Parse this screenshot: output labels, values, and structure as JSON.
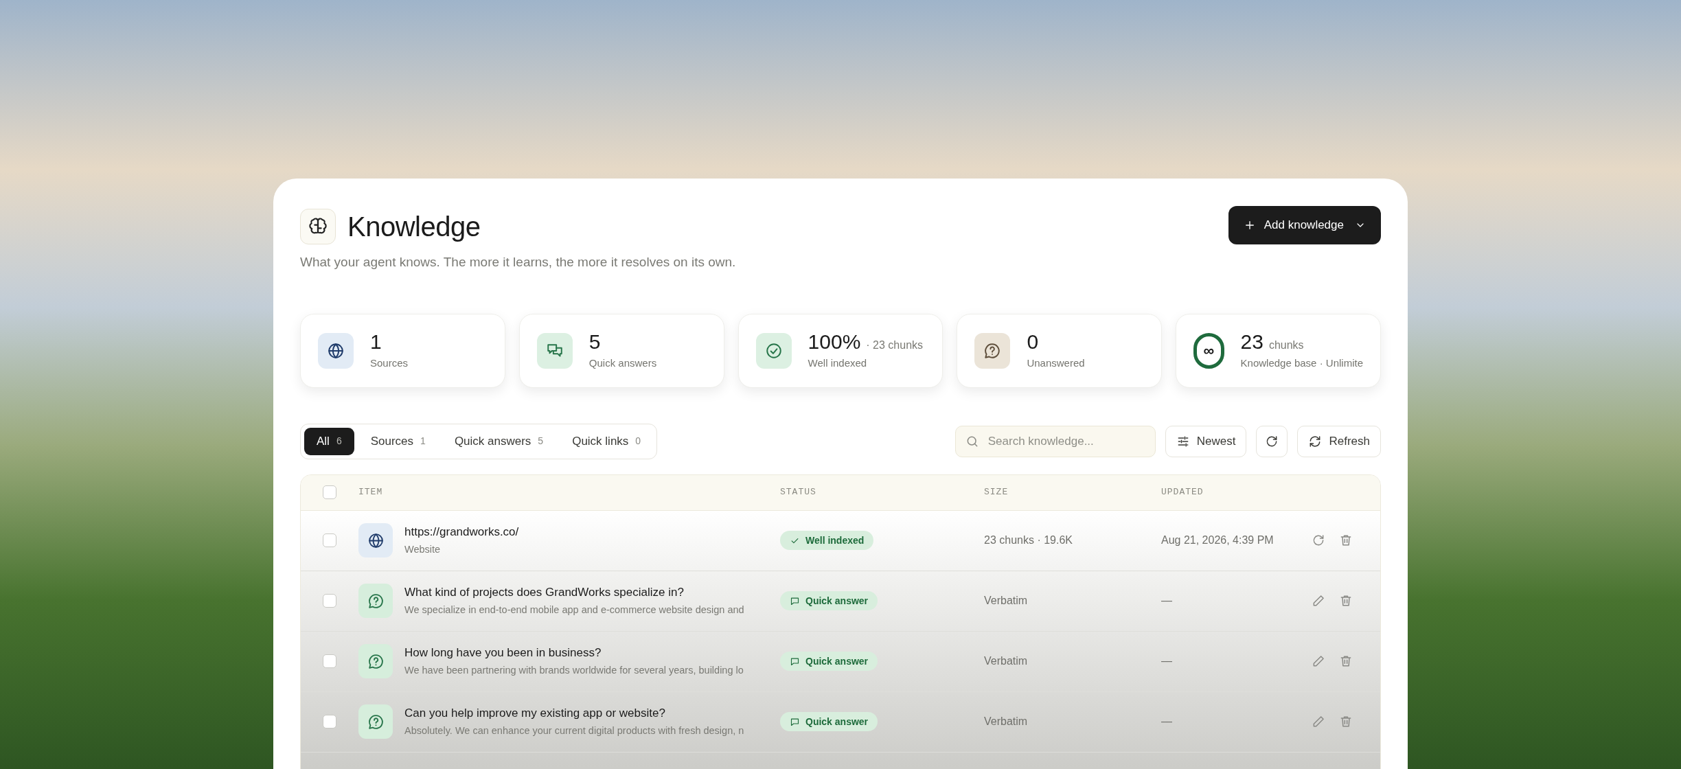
{
  "header": {
    "title": "Knowledge",
    "subtitle": "What your agent knows. The more it learns, the more it resolves on its own.",
    "add_button": "Add knowledge"
  },
  "stats": [
    {
      "kind": "sources",
      "value": "1",
      "label": "Sources"
    },
    {
      "kind": "quick_answers",
      "value": "5",
      "label": "Quick answers"
    },
    {
      "kind": "indexed",
      "value": "100%",
      "note": "· 23 chunks",
      "label": "Well indexed"
    },
    {
      "kind": "unanswered",
      "value": "0",
      "label": "Unanswered"
    },
    {
      "kind": "capacity",
      "value": "23",
      "note": "chunks",
      "label": "Knowledge base · Unlimite",
      "ring_symbol": "∞"
    }
  ],
  "tabs": [
    {
      "label": "All",
      "count": "6",
      "selected": true
    },
    {
      "label": "Sources",
      "count": "1",
      "selected": false
    },
    {
      "label": "Quick answers",
      "count": "5",
      "selected": false
    },
    {
      "label": "Quick links",
      "count": "0",
      "selected": false
    }
  ],
  "toolbar": {
    "search_placeholder": "Search knowledge...",
    "sort": "Newest",
    "refresh": "Refresh"
  },
  "table": {
    "select_all_checked": false,
    "columns": [
      "ITEM",
      "STATUS",
      "SIZE",
      "UPDATED"
    ],
    "rows": [
      {
        "kind": "website",
        "checked": false,
        "title": "https://grandworks.co/",
        "subtitle": "Website",
        "status": {
          "kind": "indexed",
          "label": "Well indexed"
        },
        "size": "23 chunks · 19.6K",
        "updated": "Aug 21, 2026, 4:39 PM"
      },
      {
        "kind": "quick_answer",
        "checked": false,
        "title": "What kind of projects does GrandWorks specialize in?",
        "subtitle": "We specialize in end-to-end mobile app and e-commerce website design and",
        "status": {
          "kind": "quick_answer",
          "label": "Quick answer"
        },
        "size": "Verbatim",
        "updated": "—"
      },
      {
        "kind": "quick_answer",
        "checked": false,
        "title": "How long have you been in business?",
        "subtitle": "We have been partnering with brands worldwide for several years, building lo",
        "status": {
          "kind": "quick_answer",
          "label": "Quick answer"
        },
        "size": "Verbatim",
        "updated": "—"
      },
      {
        "kind": "quick_answer",
        "checked": false,
        "title": "Can you help improve my existing app or website?",
        "subtitle": "Absolutely. We can enhance your current digital products with fresh design, n",
        "status": {
          "kind": "quick_answer",
          "label": "Quick answer"
        },
        "size": "Verbatim",
        "updated": "—"
      }
    ]
  }
}
